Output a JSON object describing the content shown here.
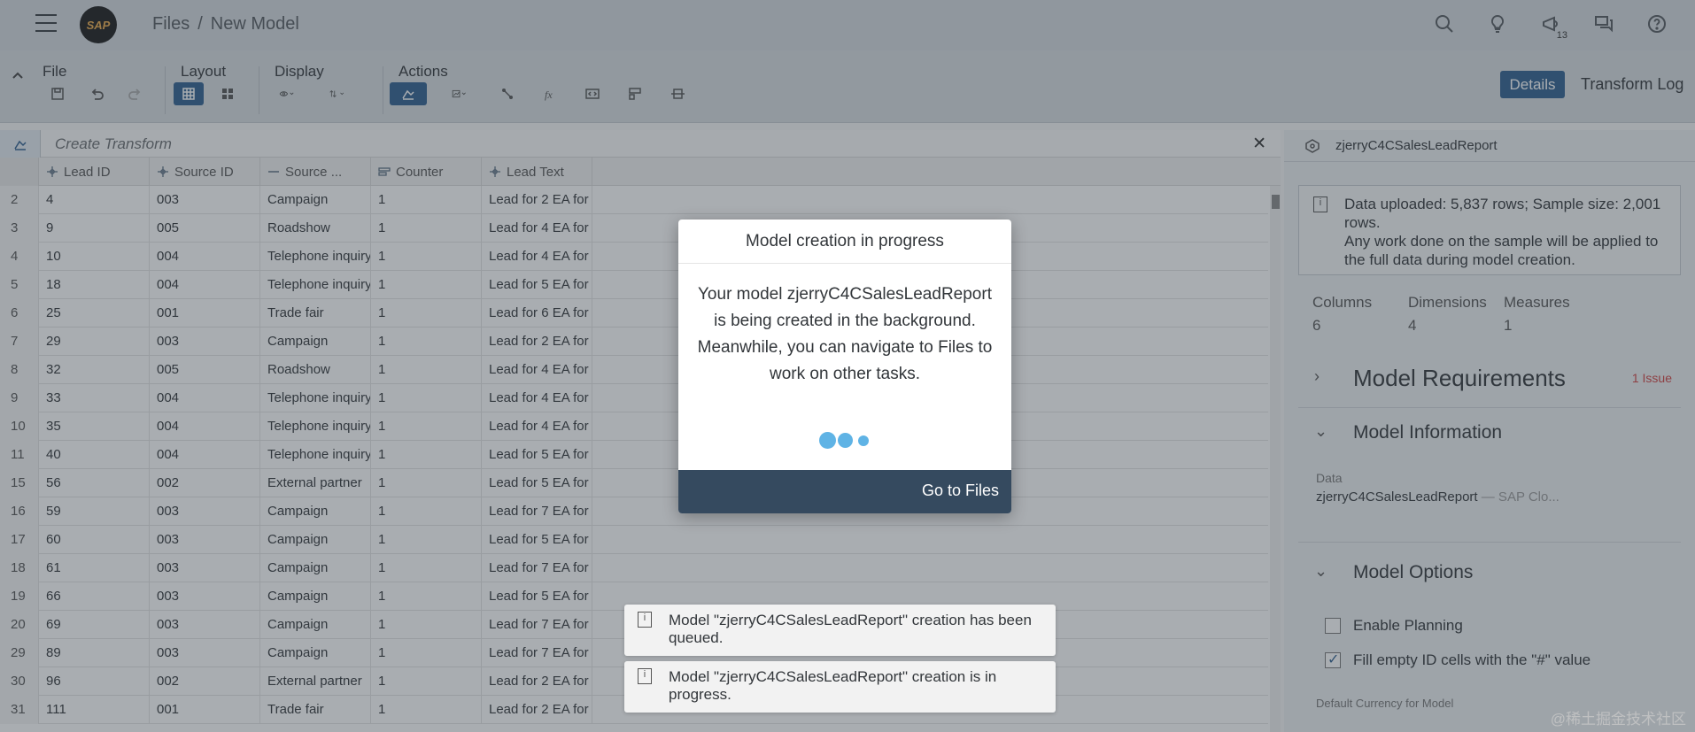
{
  "shell": {
    "logo_text": "SAP",
    "breadcrumb": [
      "Files",
      "New Model"
    ],
    "notification_count": "13"
  },
  "toolbar": {
    "groups": {
      "file": "File",
      "layout": "Layout",
      "display": "Display",
      "actions": "Actions"
    },
    "details_label": "Details",
    "transform_log_label": "Transform Log"
  },
  "transform_bar": {
    "placeholder": "Create Transform"
  },
  "grid": {
    "columns": [
      "Lead ID",
      "Source ID",
      "Source ...",
      "Counter",
      "Lead Text"
    ],
    "rows": [
      [
        "2",
        "4",
        "003",
        "Campaign",
        "1",
        "Lead for 2 EA for"
      ],
      [
        "3",
        "9",
        "005",
        "Roadshow",
        "1",
        "Lead for 4 EA for"
      ],
      [
        "4",
        "10",
        "004",
        "Telephone inquiry",
        "1",
        "Lead for 4 EA for"
      ],
      [
        "5",
        "18",
        "004",
        "Telephone inquiry",
        "1",
        "Lead for 5 EA for"
      ],
      [
        "6",
        "25",
        "001",
        "Trade fair",
        "1",
        "Lead for 6 EA for"
      ],
      [
        "7",
        "29",
        "003",
        "Campaign",
        "1",
        "Lead for 2 EA for"
      ],
      [
        "8",
        "32",
        "005",
        "Roadshow",
        "1",
        "Lead for 4 EA for"
      ],
      [
        "9",
        "33",
        "004",
        "Telephone inquiry",
        "1",
        "Lead for 4 EA for"
      ],
      [
        "10",
        "35",
        "004",
        "Telephone inquiry",
        "1",
        "Lead for 4 EA for"
      ],
      [
        "11",
        "40",
        "004",
        "Telephone inquiry",
        "1",
        "Lead for 5 EA for"
      ],
      [
        "15",
        "56",
        "002",
        "External partner",
        "1",
        "Lead for 5 EA for"
      ],
      [
        "16",
        "59",
        "003",
        "Campaign",
        "1",
        "Lead for 7 EA for"
      ],
      [
        "17",
        "60",
        "003",
        "Campaign",
        "1",
        "Lead for 5 EA for"
      ],
      [
        "18",
        "61",
        "003",
        "Campaign",
        "1",
        "Lead for 7 EA for"
      ],
      [
        "19",
        "66",
        "003",
        "Campaign",
        "1",
        "Lead for 5 EA for"
      ],
      [
        "20",
        "69",
        "003",
        "Campaign",
        "1",
        "Lead for 7 EA for"
      ],
      [
        "29",
        "89",
        "003",
        "Campaign",
        "1",
        "Lead for 7 EA for"
      ],
      [
        "30",
        "96",
        "002",
        "External partner",
        "1",
        "Lead for 2 EA for"
      ],
      [
        "31",
        "111",
        "001",
        "Trade fair",
        "1",
        "Lead for 2 EA for"
      ]
    ]
  },
  "side_panel": {
    "title": "zjerryC4CSalesLeadReport",
    "info_line1": "Data uploaded: 5,837 rows; Sample size: 2,001 rows.",
    "info_line2": "Any work done on the sample will be applied to the full data during model creation.",
    "stats": {
      "columns_label": "Columns",
      "columns_value": "6",
      "dimensions_label": "Dimensions",
      "dimensions_value": "4",
      "measures_label": "Measures",
      "measures_value": "1"
    },
    "requirements_title": "Model Requirements",
    "requirements_issue": "1 Issue",
    "information_title": "Model Information",
    "data_label": "Data",
    "data_value": "zjerryC4CSalesLeadReport",
    "data_suffix": "— SAP Clo...",
    "options_title": "Model Options",
    "enable_planning": "Enable Planning",
    "fill_empty": "Fill empty ID cells with the \"#\" value",
    "default_currency": "Default Currency for Model"
  },
  "dialog": {
    "title": "Model creation in progress",
    "body": "Your model zjerryC4CSalesLeadReport is being created in the background. Meanwhile, you can navigate to Files to work on other tasks.",
    "go_to_files": "Go to Files"
  },
  "toasts": [
    "Model \"zjerryC4CSalesLeadReport\" creation has been queued.",
    "Model \"zjerryC4CSalesLeadReport\" creation is in progress."
  ],
  "watermark": "@稀土掘金技术社区",
  "colors": {
    "accent": "#2f5f8f",
    "dialog_footer": "#354a5f",
    "loader": "#5fb3e5",
    "issue": "#d04343"
  }
}
